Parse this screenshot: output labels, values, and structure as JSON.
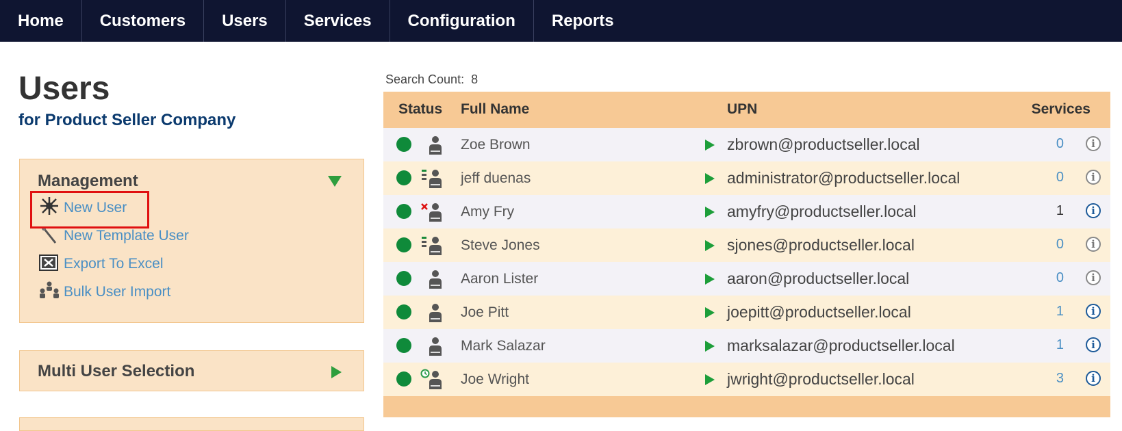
{
  "nav": {
    "items": [
      "Home",
      "Customers",
      "Users",
      "Services",
      "Configuration",
      "Reports"
    ]
  },
  "page": {
    "title": "Users",
    "subtitle": "for Product Seller Company"
  },
  "management": {
    "title": "Management",
    "items": [
      {
        "label": "New User",
        "icon": "new-user-icon"
      },
      {
        "label": "New Template User",
        "icon": "wand-icon"
      },
      {
        "label": "Export To Excel",
        "icon": "excel-icon"
      },
      {
        "label": "Bulk User Import",
        "icon": "group-icon"
      }
    ]
  },
  "multi_user": {
    "title": "Multi User Selection"
  },
  "search": {
    "label": "Search Count:",
    "count": "8"
  },
  "table": {
    "headers": {
      "status": "Status",
      "full_name": "Full Name",
      "upn": "UPN",
      "services": "Services"
    },
    "rows": [
      {
        "name": "Zoe Brown",
        "upn": "zbrown@productseller.local",
        "services": "0",
        "user_icon": "user-icon",
        "info_active": false
      },
      {
        "name": "jeff duenas",
        "upn": "administrator@productseller.local",
        "services": "0",
        "user_icon": "admin-user-icon",
        "info_active": false
      },
      {
        "name": "Amy Fry",
        "upn": "amyfry@productseller.local",
        "services": "1",
        "user_icon": "disabled-user-icon",
        "info_active": true
      },
      {
        "name": "Steve Jones",
        "upn": "sjones@productseller.local",
        "services": "0",
        "user_icon": "admin-user-icon",
        "info_active": false
      },
      {
        "name": "Aaron Lister",
        "upn": "aaron@productseller.local",
        "services": "0",
        "user_icon": "user-icon",
        "info_active": false
      },
      {
        "name": "Joe Pitt",
        "upn": "joepitt@productseller.local",
        "services": "1",
        "user_icon": "user-icon",
        "info_active": true
      },
      {
        "name": "Mark Salazar",
        "upn": "marksalazar@productseller.local",
        "services": "1",
        "user_icon": "user-icon",
        "info_active": true
      },
      {
        "name": "Joe Wright",
        "upn": "jwright@productseller.local",
        "services": "3",
        "user_icon": "scheduled-user-icon",
        "info_active": true
      }
    ]
  },
  "colors": {
    "nav_bg": "#0f1531",
    "panel_bg": "#fae3c6",
    "grid_header": "#f7c995",
    "status_active": "#0f8a3a",
    "link": "#4a8fc4",
    "highlight": "#e01010"
  }
}
